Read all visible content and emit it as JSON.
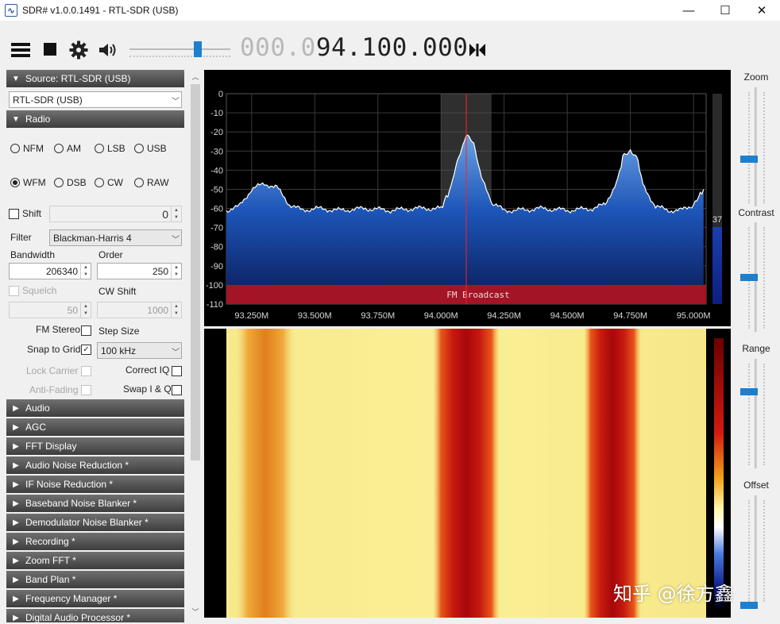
{
  "window": {
    "title": "SDR# v1.0.0.1491 - RTL-SDR (USB)",
    "controls": {
      "minimize": "—",
      "maximize": "☐",
      "close": "✕"
    }
  },
  "toolbar": {
    "freq_dim": "000.0",
    "freq_bright": "94.100.000",
    "volume_level": 0.68
  },
  "source": {
    "header": "Source: RTL-SDR (USB)",
    "device": "RTL-SDR (USB)"
  },
  "radio": {
    "header": "Radio",
    "modes": [
      {
        "label": "NFM",
        "selected": false
      },
      {
        "label": "AM",
        "selected": false
      },
      {
        "label": "LSB",
        "selected": false
      },
      {
        "label": "USB",
        "selected": false
      },
      {
        "label": "WFM",
        "selected": true
      },
      {
        "label": "DSB",
        "selected": false
      },
      {
        "label": "CW",
        "selected": false
      },
      {
        "label": "RAW",
        "selected": false
      }
    ],
    "shift_label": "Shift",
    "shift_value": "0",
    "filter_label": "Filter",
    "filter_value": "Blackman-Harris 4",
    "bandwidth_label": "Bandwidth",
    "bandwidth_value": "206340",
    "order_label": "Order",
    "order_value": "250",
    "squelch_label": "Squelch",
    "squelch_value": "50",
    "cwshift_label": "CW Shift",
    "cwshift_value": "1000",
    "fmstereo_label": "FM Stereo",
    "stepsize_label": "Step Size",
    "snap_label": "Snap to Grid",
    "step_value": "100 kHz",
    "lockcarrier_label": "Lock Carrier",
    "correctiq_label": "Correct IQ",
    "antifading_label": "Anti-Fading",
    "swapiq_label": "Swap I & Q"
  },
  "plugins": [
    "Audio",
    "AGC",
    "FFT Display",
    "Audio Noise Reduction *",
    "IF Noise Reduction *",
    "Baseband Noise Blanker *",
    "Demodulator Noise Blanker *",
    "Recording *",
    "Zoom FFT *",
    "Band Plan *",
    "Frequency Manager *",
    "Digital Audio Processor *"
  ],
  "right_panel": {
    "zoom_label": "Zoom",
    "zoom_level": 0.4,
    "contrast_label": "Contrast",
    "contrast_level": 0.5,
    "range_label": "Range",
    "range_level": 0.7,
    "offset_label": "Offset",
    "offset_level": 0.0
  },
  "spectrum": {
    "y_ticks": [
      "0",
      "-10",
      "-20",
      "-30",
      "-40",
      "-50",
      "-60",
      "-70",
      "-80",
      "-90",
      "-100",
      "-110"
    ],
    "x_ticks": [
      "93.250M",
      "93.500M",
      "93.750M",
      "94.000M",
      "94.250M",
      "94.500M",
      "94.750M",
      "95.000M"
    ],
    "band_label": "FM Broadcast",
    "level_value": "37",
    "chart_data": {
      "type": "area",
      "xlabel": "",
      "ylabel": "",
      "xlim_mhz": [
        93.15,
        95.05
      ],
      "ylim_db": [
        -110,
        0
      ],
      "tuned_mhz": 94.1,
      "filter_band_mhz": [
        94.0,
        94.2
      ],
      "x_mhz": [
        93.15,
        93.2,
        93.25,
        93.3,
        93.35,
        93.4,
        93.45,
        93.5,
        93.6,
        93.7,
        93.8,
        93.9,
        94.0,
        94.04,
        94.07,
        94.1,
        94.13,
        94.16,
        94.2,
        94.25,
        94.3,
        94.4,
        94.5,
        94.6,
        94.65,
        94.7,
        94.72,
        94.75,
        94.78,
        94.8,
        94.85,
        94.9,
        94.95,
        95.0,
        95.04
      ],
      "y_db": [
        -61,
        -59,
        -50,
        -47,
        -49,
        -58,
        -61,
        -60,
        -61,
        -60,
        -61,
        -60,
        -60,
        -49,
        -33,
        -21,
        -27,
        -43,
        -57,
        -61,
        -61,
        -60,
        -61,
        -60,
        -58,
        -45,
        -33,
        -29,
        -35,
        -48,
        -59,
        -61,
        -61,
        -58,
        -50
      ]
    }
  },
  "watermark": "知乎 @徐方鑫"
}
